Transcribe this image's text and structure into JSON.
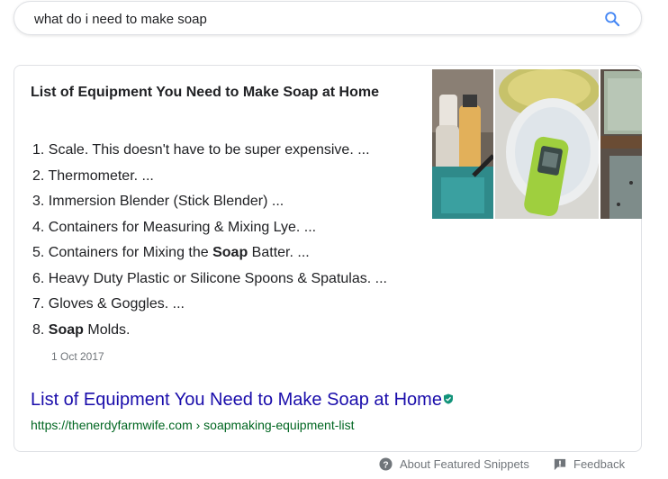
{
  "search": {
    "query": "what do i need to make soap"
  },
  "snippet": {
    "heading_pre": "List of Equipment You ",
    "heading_hl": "Need to Make Soap",
    "heading_post": " at Home",
    "steps": [
      {
        "num": "1.",
        "pre": "Scale. This doesn't have to be super expensive. ...",
        "bold": "",
        "post": ""
      },
      {
        "num": "2.",
        "pre": "Thermometer. ...",
        "bold": "",
        "post": ""
      },
      {
        "num": "3.",
        "pre": "Immersion Blender (Stick Blender) ...",
        "bold": "",
        "post": ""
      },
      {
        "num": "4.",
        "pre": "Containers for Measuring & Mixing Lye. ...",
        "bold": "",
        "post": ""
      },
      {
        "num": "5.",
        "pre": "Containers for Mixing the ",
        "bold": "Soap",
        "post": " Batter. ..."
      },
      {
        "num": "6.",
        "pre": "Heavy Duty Plastic or Silicone Spoons & Spatulas. ...",
        "bold": "",
        "post": ""
      },
      {
        "num": "7.",
        "pre": "Gloves & Goggles. ...",
        "bold": "",
        "post": ""
      },
      {
        "num": "8.",
        "pre": "",
        "bold": "Soap",
        "post": " Molds."
      }
    ],
    "date": "1 Oct 2017",
    "result_title": "List of Equipment You Need to Make Soap at Home",
    "result_url": "https://thenerdyfarmwife.com › soapmaking-equipment-list"
  },
  "footer": {
    "about_label": "About Featured Snippets",
    "feedback_label": "Feedback"
  },
  "icons": {
    "search": "search-icon",
    "verified": "verified-shield-icon",
    "help": "help-circle-icon",
    "feedback": "feedback-flag-icon"
  },
  "colors": {
    "link": "#1a0dab",
    "url": "#006621",
    "accent_blue": "#4285f4",
    "muted": "#70757a"
  }
}
